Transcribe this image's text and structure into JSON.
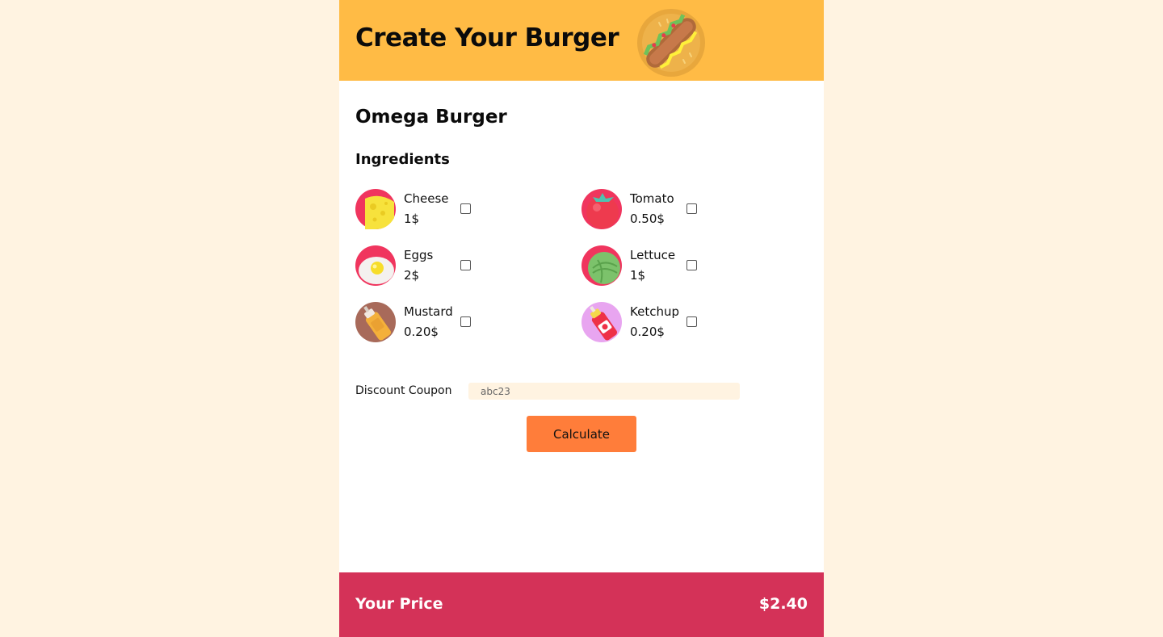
{
  "header": {
    "title": "Create Your Burger",
    "logo_icon": "hotdog-icon",
    "background": "#ffbb45"
  },
  "burger": {
    "name": "Omega Burger"
  },
  "ingredients": {
    "heading": "Ingredients",
    "items": [
      {
        "name": "Cheese",
        "price": "1$",
        "icon": "cheese-icon",
        "checked": false
      },
      {
        "name": "Tomato",
        "price": "0.50$",
        "icon": "tomato-icon",
        "checked": false
      },
      {
        "name": "Eggs",
        "price": "2$",
        "icon": "egg-icon",
        "checked": false
      },
      {
        "name": "Lettuce",
        "price": "1$",
        "icon": "lettuce-icon",
        "checked": false
      },
      {
        "name": "Mustard",
        "price": "0.20$",
        "icon": "mustard-icon",
        "checked": false
      },
      {
        "name": "Ketchup",
        "price": "0.20$",
        "icon": "ketchup-icon",
        "checked": false
      }
    ]
  },
  "coupon": {
    "label": "Discount Coupon",
    "value": "abc23"
  },
  "calculate": {
    "label": "Calculate",
    "color": "#ff7d3a"
  },
  "footer": {
    "label": "Your Price",
    "price": "$2.40",
    "background": "#d43258"
  }
}
